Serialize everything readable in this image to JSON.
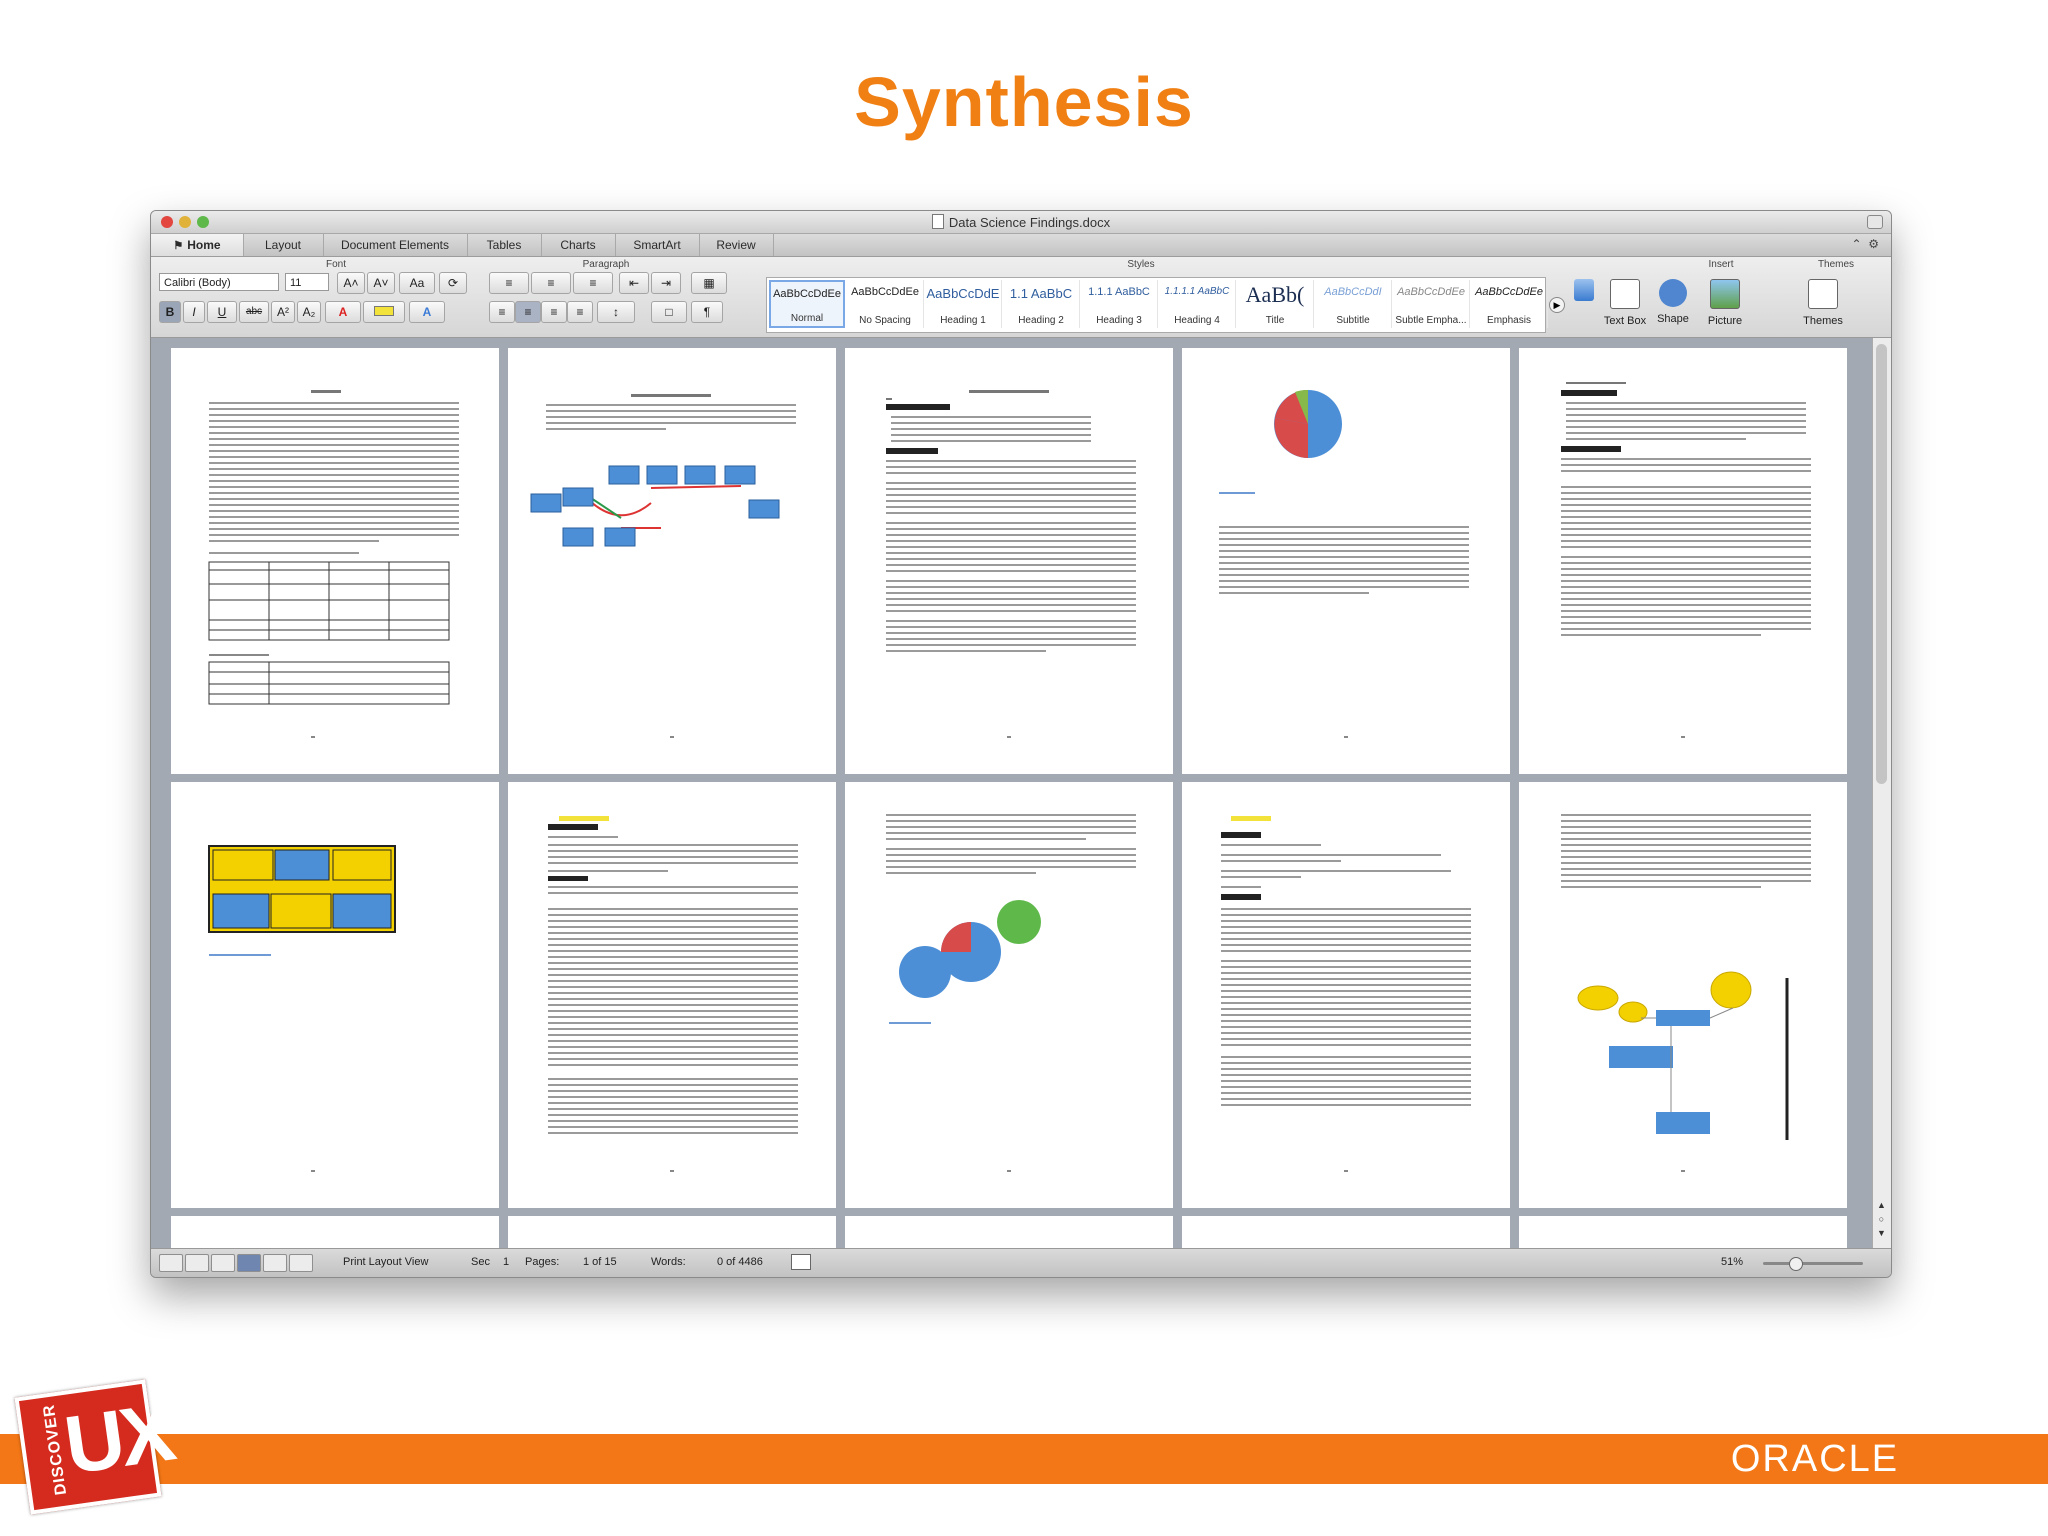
{
  "slide": {
    "title": "Synthesis",
    "accent_color": "#f08014",
    "footer_color": "#f37716"
  },
  "window": {
    "title": "Data Science Findings.docx",
    "icons": [
      "close-icon",
      "minimize-icon",
      "zoom-icon",
      "document-icon"
    ]
  },
  "tabs": [
    {
      "label": "Home",
      "active": true
    },
    {
      "label": "Layout"
    },
    {
      "label": "Document Elements"
    },
    {
      "label": "Tables"
    },
    {
      "label": "Charts"
    },
    {
      "label": "SmartArt"
    },
    {
      "label": "Review"
    }
  ],
  "ribbon": {
    "groups": {
      "font": "Font",
      "paragraph": "Paragraph",
      "styles": "Styles",
      "insert": "Insert",
      "themes": "Themes"
    },
    "font_name": "Calibri (Body)",
    "font_size": "11",
    "styles": [
      {
        "sample": "AaBbCcDdEe",
        "name": "Normal",
        "selected": true
      },
      {
        "sample": "AaBbCcDdEe",
        "name": "No Spacing"
      },
      {
        "sample": "AaBbCcDdE",
        "name": "Heading 1"
      },
      {
        "sample": "1.1 AaBbC",
        "name": "Heading 2"
      },
      {
        "sample": "1.1.1 AaBbC",
        "name": "Heading 3"
      },
      {
        "sample": "1.1.1.1 AaBbC",
        "name": "Heading 4"
      },
      {
        "sample": "AaBb(",
        "name": "Title"
      },
      {
        "sample": "AaBbCcDdI",
        "name": "Subtitle"
      },
      {
        "sample": "AaBbCcDdEe",
        "name": "Subtle Empha..."
      },
      {
        "sample": "AaBbCcDdEe",
        "name": "Emphasis"
      }
    ],
    "insert_items": [
      {
        "label": "Text Box",
        "icon": "text-box-icon"
      },
      {
        "label": "Shape",
        "icon": "shape-icon"
      },
      {
        "label": "Picture",
        "icon": "picture-icon"
      }
    ],
    "themes_label": "Themes"
  },
  "status": {
    "view": "Print Layout View",
    "sec_label": "Sec",
    "sec_value": "1",
    "pages_label": "Pages:",
    "pages_value": "1 of 15",
    "words_label": "Words:",
    "words_value": "0 of 4486",
    "zoom": "51%"
  },
  "brand": {
    "oracle": "ORACLE",
    "discover": "DISCOVER",
    "ux": "UX"
  }
}
